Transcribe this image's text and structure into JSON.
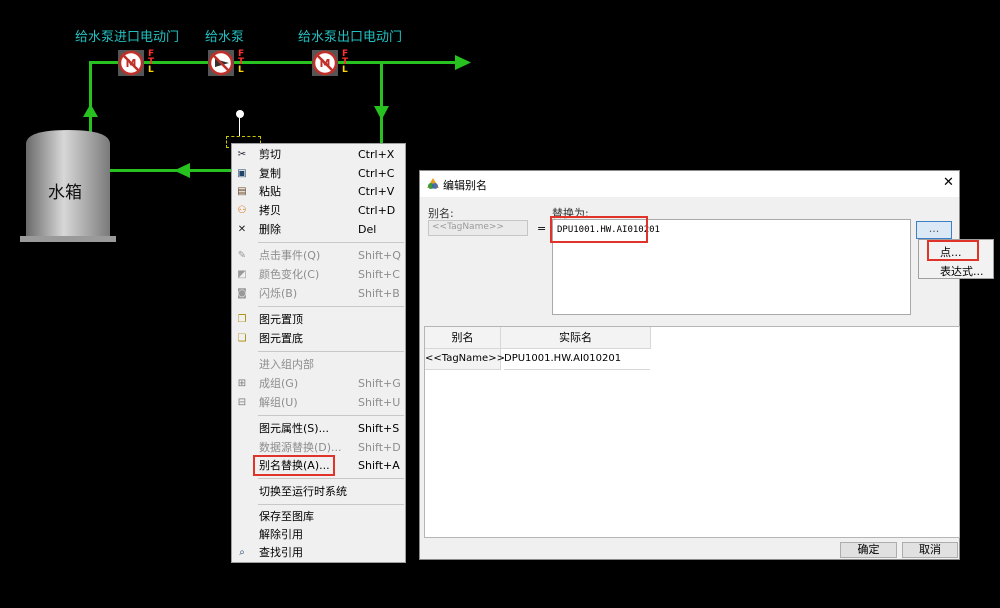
{
  "process": {
    "labels": {
      "inlet_valve": "给水泵进口电动门",
      "pump": "给水泵",
      "outlet_valve": "给水泵出口电动门",
      "tank": "水箱"
    },
    "ftl": {
      "f": "F",
      "t": "T",
      "l": "L"
    },
    "colors": {
      "pipe": "#27c21f",
      "label": "#22c0c0",
      "valve_ring": "#c0302a"
    }
  },
  "context_menu": {
    "items": [
      {
        "icon": "cut-icon",
        "glyph": "✂",
        "label": "剪切",
        "shortcut": "Ctrl+X",
        "enabled": true
      },
      {
        "icon": "copy-icon",
        "glyph": "▣",
        "label": "复制",
        "shortcut": "Ctrl+C",
        "enabled": true
      },
      {
        "icon": "paste-icon",
        "glyph": "▤",
        "label": "粘贴",
        "shortcut": "Ctrl+V",
        "enabled": true
      },
      {
        "icon": "clone-icon",
        "glyph": "⚇",
        "label": "拷贝",
        "shortcut": "Ctrl+D",
        "enabled": true
      },
      {
        "icon": "delete-icon",
        "glyph": "✕",
        "label": "删除",
        "shortcut": "Del",
        "enabled": true
      },
      {
        "icon": "click-event-icon",
        "glyph": "✎",
        "label": "点击事件(Q)",
        "shortcut": "Shift+Q",
        "enabled": false
      },
      {
        "icon": "color-change-icon",
        "glyph": "◩",
        "label": "颜色变化(C)",
        "shortcut": "Shift+C",
        "enabled": false
      },
      {
        "icon": "blink-icon",
        "glyph": "◙",
        "label": "闪烁(B)",
        "shortcut": "Shift+B",
        "enabled": false
      },
      {
        "icon": "bring-to-front-icon",
        "glyph": "❐",
        "label": "图元置顶",
        "shortcut": "",
        "enabled": true
      },
      {
        "icon": "send-to-back-icon",
        "glyph": "❏",
        "label": "图元置底",
        "shortcut": "",
        "enabled": true
      },
      {
        "icon": "",
        "glyph": "",
        "label": "进入组内部",
        "shortcut": "",
        "enabled": false
      },
      {
        "icon": "group-icon",
        "glyph": "⊞",
        "label": "成组(G)",
        "shortcut": "Shift+G",
        "enabled": false
      },
      {
        "icon": "ungroup-icon",
        "glyph": "⊟",
        "label": "解组(U)",
        "shortcut": "Shift+U",
        "enabled": false
      },
      {
        "icon": "",
        "glyph": "",
        "label": "图元属性(S)...",
        "shortcut": "Shift+S",
        "enabled": true
      },
      {
        "icon": "",
        "glyph": "",
        "label": "数据源替换(D)...",
        "shortcut": "Shift+D",
        "enabled": false
      },
      {
        "icon": "",
        "glyph": "",
        "label": "别名替换(A)...",
        "shortcut": "Shift+A",
        "enabled": true
      },
      {
        "icon": "",
        "glyph": "",
        "label": "切换至运行时系统",
        "shortcut": "",
        "enabled": true
      },
      {
        "icon": "",
        "glyph": "",
        "label": "保存至图库",
        "shortcut": "",
        "enabled": true
      },
      {
        "icon": "",
        "glyph": "",
        "label": "解除引用",
        "shortcut": "",
        "enabled": true
      },
      {
        "icon": "search-icon",
        "glyph": "⌕",
        "label": "查找引用",
        "shortcut": "",
        "enabled": true
      }
    ]
  },
  "dialog": {
    "title": "编辑别名",
    "close_glyph": "✕",
    "alias_label": "别名:",
    "alias_value": "<<TagName>>",
    "equals": "=",
    "replace_label": "替换为:",
    "replace_value": "DPU1001.HW.AI010201",
    "browse_button": "...",
    "table": {
      "headers": [
        "别名",
        "实际名"
      ],
      "rows": [
        [
          "<<TagName>>",
          "DPU1001.HW.AI010201"
        ]
      ]
    },
    "ok": "确定",
    "cancel": "取消",
    "popup": {
      "point": "点...",
      "expression": "表达式..."
    },
    "highlight_color": "#e0342a"
  }
}
